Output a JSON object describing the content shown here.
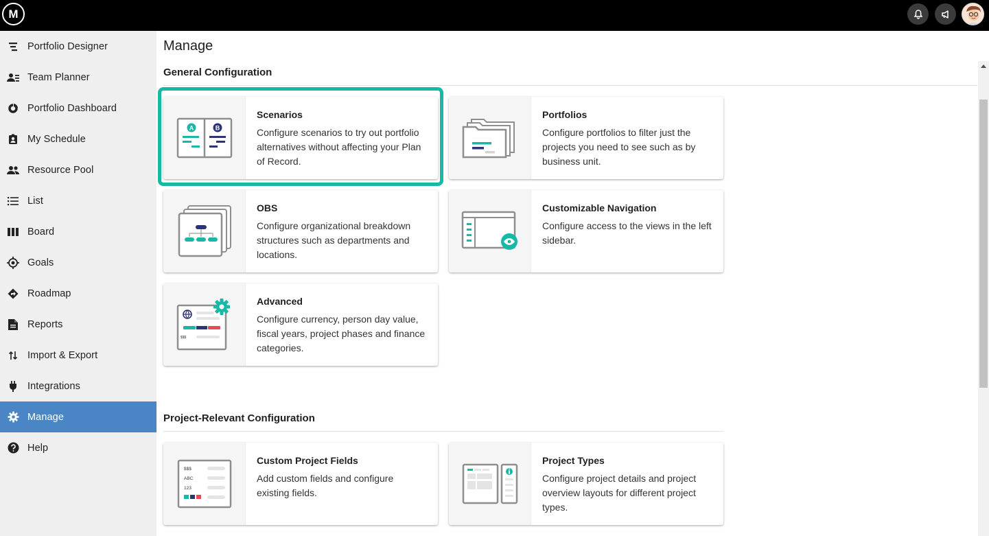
{
  "topbar": {
    "logo_text": "M",
    "icons": [
      "bell-icon",
      "megaphone-icon",
      "avatar"
    ]
  },
  "sidebar": {
    "items": [
      {
        "label": "Portfolio Designer",
        "icon": "portfolio-designer-icon"
      },
      {
        "label": "Team Planner",
        "icon": "team-planner-icon"
      },
      {
        "label": "Portfolio Dashboard",
        "icon": "dashboard-icon"
      },
      {
        "label": "My Schedule",
        "icon": "schedule-icon"
      },
      {
        "label": "Resource Pool",
        "icon": "people-icon"
      },
      {
        "label": "List",
        "icon": "list-icon"
      },
      {
        "label": "Board",
        "icon": "board-icon"
      },
      {
        "label": "Goals",
        "icon": "goals-icon"
      },
      {
        "label": "Roadmap",
        "icon": "roadmap-icon"
      },
      {
        "label": "Reports",
        "icon": "reports-icon"
      },
      {
        "label": "Import & Export",
        "icon": "import-export-icon"
      },
      {
        "label": "Integrations",
        "icon": "plug-icon"
      },
      {
        "label": "Manage",
        "icon": "gear-icon",
        "active": true
      },
      {
        "label": "Help",
        "icon": "help-icon"
      }
    ]
  },
  "main": {
    "title": "Manage",
    "sections": [
      {
        "title": "General Configuration",
        "cards": [
          {
            "title": "Scenarios",
            "description": "Configure scenarios to try out portfolio alternatives without affecting your Plan of Record.",
            "icon": "scenarios-icon",
            "highlighted": true
          },
          {
            "title": "Portfolios",
            "description": "Configure portfolios to filter just the projects you need to see such as by business unit.",
            "icon": "portfolios-icon"
          },
          {
            "title": "OBS",
            "description": "Configure organizational breakdown structures such as departments and locations.",
            "icon": "obs-icon"
          },
          {
            "title": "Customizable Navigation",
            "description": "Configure access to the views in the left sidebar.",
            "icon": "navigation-icon"
          },
          {
            "title": "Advanced",
            "description": "Configure currency, person day value, fiscal years, project phases and finance categories.",
            "icon": "advanced-icon"
          }
        ]
      },
      {
        "title": "Project-Relevant Configuration",
        "cards": [
          {
            "title": "Custom Project Fields",
            "description": "Add custom fields and configure existing fields.",
            "icon": "custom-fields-icon"
          },
          {
            "title": "Project Types",
            "description": "Configure project details and project overview layouts for different project types.",
            "icon": "project-types-icon"
          }
        ]
      }
    ]
  },
  "thumb_text": {
    "scenario_a": "A",
    "scenario_b": "B",
    "fields_money": "$$$",
    "fields_text": "ABC",
    "fields_number": "123",
    "advanced_money": "$$$"
  },
  "colors": {
    "accent": "#17b8a6",
    "sidebar_active": "#4a86c5",
    "navy": "#2c3473",
    "red": "#e84b55"
  }
}
